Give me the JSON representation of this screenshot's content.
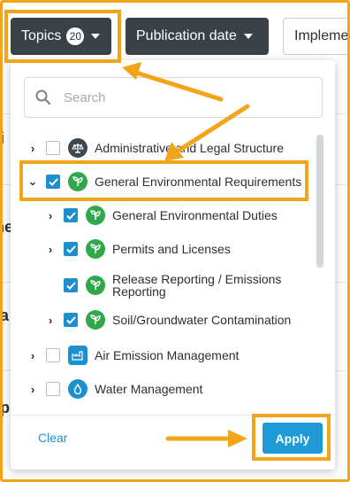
{
  "filters": {
    "topics_label": "Topics",
    "topics_count": "20",
    "publication_label": "Publication date",
    "implementation_label": "Impleme"
  },
  "background": {
    "chars": [
      "i",
      "ne",
      "a",
      "p"
    ]
  },
  "dropdown": {
    "search_placeholder": "Search",
    "items": [
      {
        "label": "Administrative and Legal Structure",
        "checked": false,
        "expandable": true,
        "level": 0,
        "icon": "scales-icon",
        "icon_color": "#3c4850"
      },
      {
        "label": "General Environmental Requirements",
        "checked": true,
        "expanded": true,
        "level": 0,
        "icon": "leaf-icon",
        "icon_color": "#2ea84a"
      },
      {
        "label": "General Environmental Duties",
        "checked": true,
        "expandable": true,
        "level": 1,
        "icon": "leaf-icon",
        "icon_color": "#2ea84a"
      },
      {
        "label": "Permits and Licenses",
        "checked": true,
        "expandable": true,
        "level": 1,
        "icon": "leaf-icon",
        "icon_color": "#2ea84a"
      },
      {
        "label": "Release Reporting / Emissions Reporting",
        "label_line1": "Release Reporting / Emissions",
        "label_line2": "Reporting",
        "checked": true,
        "expandable": false,
        "level": 1,
        "icon": "leaf-icon",
        "icon_color": "#2ea84a"
      },
      {
        "label": "Soil/Groundwater Contamination",
        "checked": true,
        "expandable": true,
        "level": 1,
        "icon": "leaf-icon",
        "icon_color": "#2ea84a"
      },
      {
        "label": "Air Emission Management",
        "checked": false,
        "expandable": true,
        "level": 0,
        "icon": "factory-icon",
        "icon_color": "#1c8fd0"
      },
      {
        "label": "Water Management",
        "checked": false,
        "expandable": true,
        "level": 0,
        "icon": "water-drop-icon",
        "icon_color": "#1c8fd0"
      }
    ],
    "clear_label": "Clear",
    "apply_label": "Apply"
  },
  "colors": {
    "accent": "#1e9ad6",
    "highlight": "#f2a51a",
    "button_dark": "#3a4248"
  }
}
